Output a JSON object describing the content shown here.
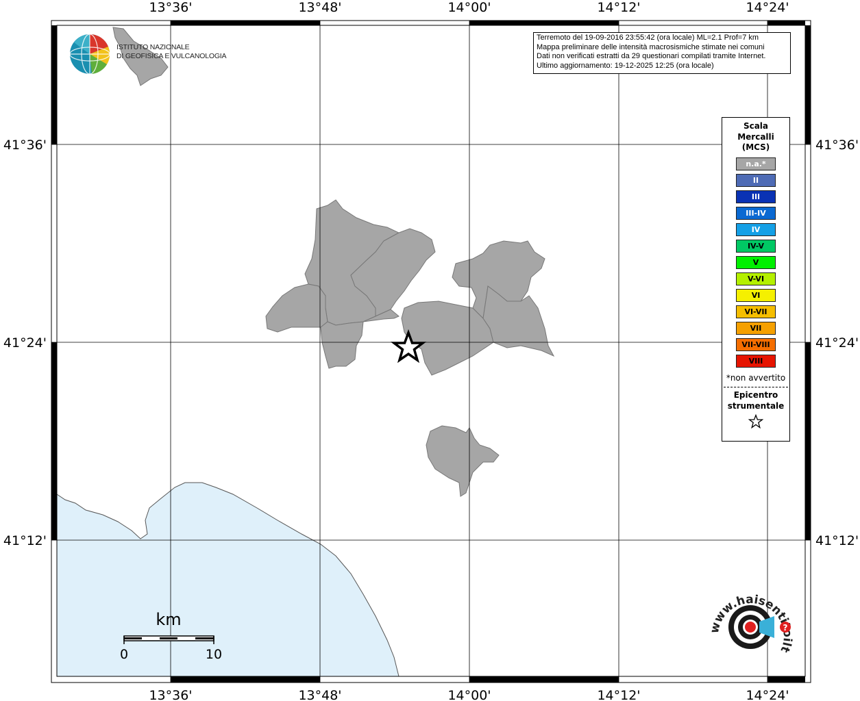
{
  "info": {
    "line1": "Terremoto del 19-09-2016 23:55:42 (ora locale) ML=2.1 Prof=7 km",
    "line2": "Mappa preliminare delle intensità macrosismiche stimate nei comuni",
    "line3": "Dati non verificati estratti da 29 questionari compilati tramite Internet.",
    "line4": "Ultimo aggiornamento: 19-12-2025 12:25 (ora locale)"
  },
  "axes": {
    "lon_labels": [
      "13°36'",
      "13°48'",
      "14°00'",
      "14°12'",
      "14°24'"
    ],
    "lat_labels": [
      "41°36'",
      "41°24'",
      "41°12'"
    ]
  },
  "logo": {
    "line1": "ISTITUTO NAZIONALE",
    "line2": "DI GEOFISICA E VULCANOLOGIA"
  },
  "legend": {
    "title1": "Scala",
    "title2": "Mercalli",
    "title3": "(MCS)",
    "classes": [
      {
        "label": "n.a.*",
        "color": "#a6a6a6",
        "text": "#ffffff"
      },
      {
        "label": "II",
        "color": "#4e6bb5",
        "text": "#ffffff"
      },
      {
        "label": "III",
        "color": "#0a32b4",
        "text": "#ffffff"
      },
      {
        "label": "III-IV",
        "color": "#0a69d2",
        "text": "#ffffff"
      },
      {
        "label": "IV",
        "color": "#14a0e6",
        "text": "#ffffff"
      },
      {
        "label": "IV-V",
        "color": "#00c864",
        "text": "#000000"
      },
      {
        "label": "V",
        "color": "#00f000",
        "text": "#000000"
      },
      {
        "label": "V-VI",
        "color": "#b4f000",
        "text": "#000000"
      },
      {
        "label": "VI",
        "color": "#f5f000",
        "text": "#000000"
      },
      {
        "label": "VI-VII",
        "color": "#f5be00",
        "text": "#000000"
      },
      {
        "label": "VII",
        "color": "#f5a000",
        "text": "#000000"
      },
      {
        "label": "VII-VIII",
        "color": "#f56e00",
        "text": "#000000"
      },
      {
        "label": "VIII",
        "color": "#e61400",
        "text": "#000000"
      }
    ],
    "note": "*non avvertito",
    "epicentre1": "Epicentro",
    "epicentre2": "strumentale"
  },
  "scalebar": {
    "unit": "km",
    "start": "0",
    "end": "10"
  },
  "hsit_logo": "www.haisentitoilterremoto.it",
  "colors": {
    "sea": "#dff0fa",
    "municipality": "#a6a6a6",
    "grid": "#000000"
  }
}
